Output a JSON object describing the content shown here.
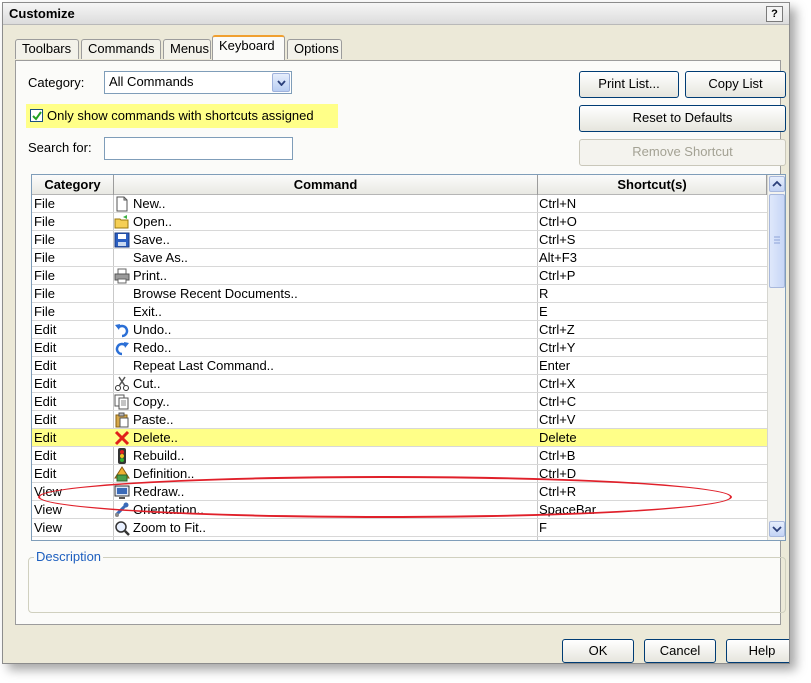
{
  "window": {
    "title": "Customize",
    "help_label": "?"
  },
  "tabs": [
    {
      "label": "Toolbars"
    },
    {
      "label": "Commands"
    },
    {
      "label": "Menus"
    },
    {
      "label": "Keyboard",
      "active": true
    },
    {
      "label": "Options"
    }
  ],
  "category": {
    "label": "Category:",
    "value": "All Commands"
  },
  "only_shortcuts": {
    "label": "Only show commands with shortcuts assigned",
    "checked": true
  },
  "search": {
    "label": "Search for:",
    "value": ""
  },
  "buttons": {
    "print_list": "Print List...",
    "copy_list": "Copy List",
    "reset_defaults": "Reset to Defaults",
    "remove_shortcut": "Remove Shortcut",
    "ok": "OK",
    "cancel": "Cancel",
    "help": "Help"
  },
  "table": {
    "headers": [
      "Category",
      "Command",
      "Shortcut(s)"
    ],
    "rows": [
      {
        "category": "File",
        "command": "New..",
        "shortcut": "Ctrl+N",
        "icon": "new-document-icon"
      },
      {
        "category": "File",
        "command": "Open..",
        "shortcut": "Ctrl+O",
        "icon": "open-folder-icon"
      },
      {
        "category": "File",
        "command": "Save..",
        "shortcut": "Ctrl+S",
        "icon": "save-disk-icon"
      },
      {
        "category": "File",
        "command": "Save As..",
        "shortcut": "Alt+F3",
        "icon": ""
      },
      {
        "category": "File",
        "command": "Print..",
        "shortcut": "Ctrl+P",
        "icon": "printer-icon"
      },
      {
        "category": "File",
        "command": "Browse Recent Documents..",
        "shortcut": "R",
        "icon": ""
      },
      {
        "category": "File",
        "command": "Exit..",
        "shortcut": "E",
        "icon": ""
      },
      {
        "category": "Edit",
        "command": "Undo..",
        "shortcut": "Ctrl+Z",
        "icon": "undo-arrow-icon"
      },
      {
        "category": "Edit",
        "command": "Redo..",
        "shortcut": "Ctrl+Y",
        "icon": "redo-arrow-icon"
      },
      {
        "category": "Edit",
        "command": "Repeat Last Command..",
        "shortcut": "Enter",
        "icon": ""
      },
      {
        "category": "Edit",
        "command": "Cut..",
        "shortcut": "Ctrl+X",
        "icon": "scissors-icon"
      },
      {
        "category": "Edit",
        "command": "Copy..",
        "shortcut": "Ctrl+C",
        "icon": "copy-pages-icon"
      },
      {
        "category": "Edit",
        "command": "Paste..",
        "shortcut": "Ctrl+V",
        "icon": "paste-clipboard-icon"
      },
      {
        "category": "Edit",
        "command": "Delete..",
        "shortcut": "Delete",
        "icon": "delete-x-icon",
        "highlighted": true
      },
      {
        "category": "Edit",
        "command": "Rebuild..",
        "shortcut": "Ctrl+B",
        "icon": "traffic-light-icon"
      },
      {
        "category": "Edit",
        "command": "Definition..",
        "shortcut": "Ctrl+D",
        "icon": "definition-icon"
      },
      {
        "category": "View",
        "command": "Redraw..",
        "shortcut": "Ctrl+R",
        "icon": "monitor-icon"
      },
      {
        "category": "View",
        "command": "Orientation..",
        "shortcut": "SpaceBar",
        "icon": "orientation-icon"
      },
      {
        "category": "View",
        "command": "Zoom to Fit..",
        "shortcut": "F",
        "icon": "zoom-magnifier-icon"
      }
    ]
  },
  "description": {
    "label": "Description"
  },
  "colors": {
    "highlight": "#ffff88",
    "circle": "#e0202a",
    "dialog_bg": "#ece9d8"
  }
}
